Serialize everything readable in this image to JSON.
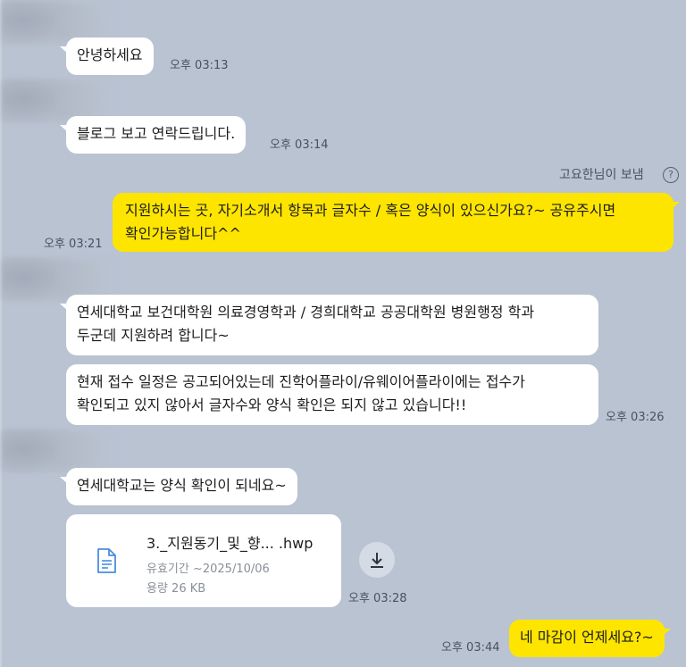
{
  "messages": [
    {
      "text": "안녕하세요",
      "time": "오후 03:13"
    },
    {
      "text": "블로그 보고 연락드립니다.",
      "time": "오후 03:14"
    },
    {
      "sender": "고요한님이 보냄",
      "line1": "지원하시는 곳, 자기소개서 항목과 글자수 / 혹은 양식이 있으신가요?~ 공유주시면",
      "line2": "확인가능합니다^^",
      "time": "오후 03:21"
    },
    {
      "line1": "연세대학교 보건대학원 의료경영학과 / 경희대학교 공공대학원 병원행정 학과",
      "line2": "두군데 지원하려 합니다~"
    },
    {
      "line1": "현재 접수 일정은 공고되어있는데 진학어플라이/유웨이어플라이에는 접수가",
      "line2": "확인되고 있지 않아서 글자수와 양식 확인은 되지 않고 있습니다!!",
      "time": "오후 03:26"
    },
    {
      "text": "연세대학교는 양식 확인이 되네요~"
    },
    {
      "file": {
        "name": "3._지원동기_및_향... .hwp",
        "expiry": "유효기간 ~2025/10/06",
        "size": "용량 26 KB"
      },
      "time": "오후 03:28"
    },
    {
      "text": "네 마감이 언제세요?~",
      "time": "오후 03:44"
    }
  ],
  "icons": {
    "help": "question-circle-icon",
    "file": "document-icon",
    "download": "download-icon"
  },
  "help_glyph": "?",
  "colors": {
    "background": "#b9c3d2",
    "mine_bubble": "#fee500",
    "their_bubble": "#ffffff",
    "file_icon": "#4a8ee0"
  }
}
